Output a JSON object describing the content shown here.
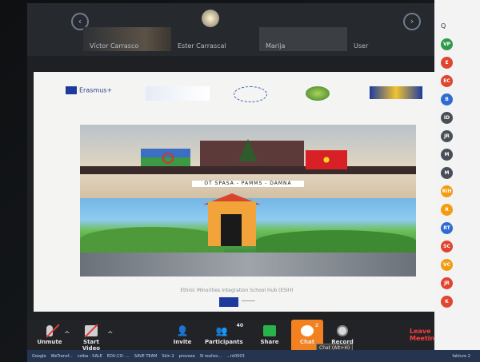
{
  "top_bar": {
    "participants": [
      "Víctor Carrasco",
      "Ester Carrascal",
      "Marija",
      "User"
    ]
  },
  "logos": {
    "erasmus": "Erasmus+"
  },
  "slide": {
    "banner_text": "OT SPASA - PAMMS - DAMNA",
    "caption": "Ethnic Minorities Integration School Hub (ESIH)"
  },
  "participants_panel": {
    "search_label": "Q",
    "initials": [
      "VP",
      "E",
      "EC",
      "B",
      "ID",
      "JR",
      "M",
      "M",
      "RIH",
      "R",
      "RT",
      "SC",
      "VC",
      "JR",
      "K"
    ],
    "colors": [
      "#2f9a4a",
      "#e0452f",
      "#e0452f",
      "#2f6bd1",
      "#4a4f57",
      "#4a4f57",
      "#4a4f57",
      "#4a4f57",
      "#f39c12",
      "#f39c12",
      "#2f6bd1",
      "#e0452f",
      "#f39c12",
      "#e0452f",
      "#e0452f"
    ]
  },
  "toolbar": {
    "unmute": "Unmute",
    "start_video": "Start Video",
    "invite": "Invite",
    "participants": "Participants",
    "participants_count": "40",
    "share": "Share",
    "chat": "Chat",
    "chat_badge": "2",
    "record": "Record",
    "leave": "Leave Meeting",
    "chat_tooltip": "Chat (Alt+H)"
  },
  "taskbar": {
    "items": [
      "Google",
      "WeTransf...",
      "ceiba - SALE",
      "EDU.CO- ...",
      "SAVE TEAM",
      "Skin 2",
      "proveza",
      "SI realizo...",
      "...nt0003",
      "fakture 2"
    ]
  }
}
